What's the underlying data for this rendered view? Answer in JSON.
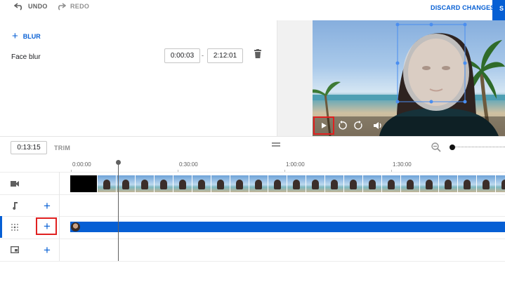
{
  "toolbar": {
    "undo_label": "UNDO",
    "redo_label": "REDO",
    "discard_label": "DISCARD CHANGES",
    "save_label": "S"
  },
  "editor": {
    "add_blur_label": "BLUR",
    "rows": [
      {
        "label": "Face blur",
        "start": "0:00:03",
        "end": "2:12:01"
      }
    ]
  },
  "preview": {
    "description_icons": [
      "play-icon",
      "rewind-icon",
      "forward-icon",
      "volume-icon"
    ]
  },
  "timeline": {
    "current_time": "0:13:15",
    "trim_label": "TRIM",
    "ticks": [
      "0:00:00",
      "0:30:00",
      "1:00:00",
      "1:30:00"
    ]
  },
  "colors": {
    "accent": "#065fd4",
    "highlight": "#e02020"
  }
}
